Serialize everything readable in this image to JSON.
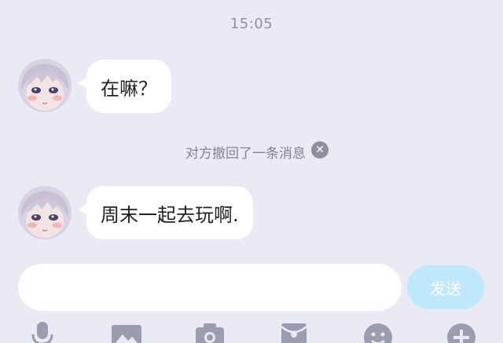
{
  "chat": {
    "timestamp": "15:05",
    "messages": [
      {
        "text": "在嘛？"
      },
      {
        "text": "周末一起去玩啊."
      }
    ],
    "recall_notice": "对方撤回了一条消息",
    "recall_close_symbol": "✕"
  },
  "composer": {
    "placeholder": "",
    "value": "",
    "send_label": "发送"
  },
  "toolbar": {
    "icons": [
      "microphone-icon",
      "image-icon",
      "camera-icon",
      "red-packet-icon",
      "emoji-icon",
      "plus-icon"
    ]
  },
  "colors": {
    "background": "#e9eaf4",
    "bubble": "#ffffff",
    "send_button": "#bfe9fb",
    "icon": "#9a9db0"
  }
}
